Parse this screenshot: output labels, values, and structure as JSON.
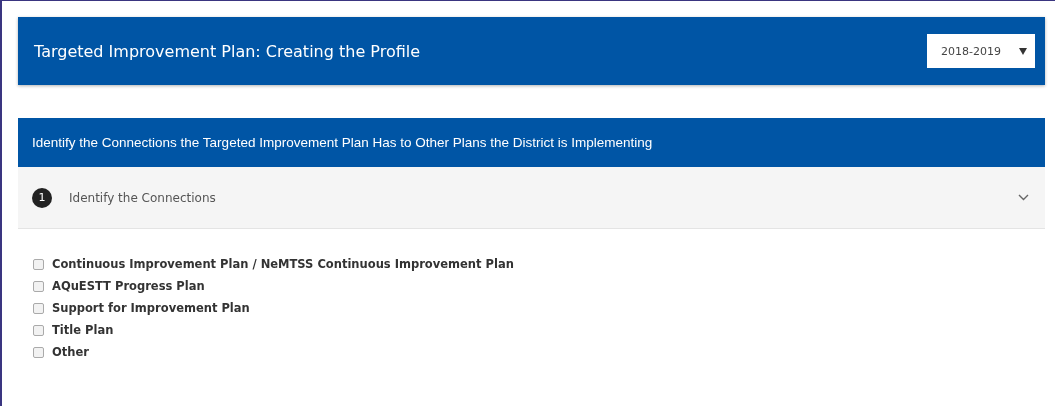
{
  "header": {
    "title": "Targeted Improvement Plan: Creating the Profile",
    "year_select": {
      "value": "2018-2019"
    }
  },
  "section": {
    "title": "Identify the Connections the Targeted Improvement Plan Has to Other Plans the District is Implementing",
    "step": {
      "number": "1",
      "title": "Identify the Connections",
      "expanded": true
    },
    "options": [
      {
        "label": "Continuous Improvement Plan / NeMTSS Continuous Improvement Plan",
        "checked": false
      },
      {
        "label": "AQuESTT Progress Plan",
        "checked": false
      },
      {
        "label": "Support for Improvement Plan",
        "checked": false
      },
      {
        "label": "Title Plan",
        "checked": false
      },
      {
        "label": "Other",
        "checked": false
      }
    ]
  }
}
